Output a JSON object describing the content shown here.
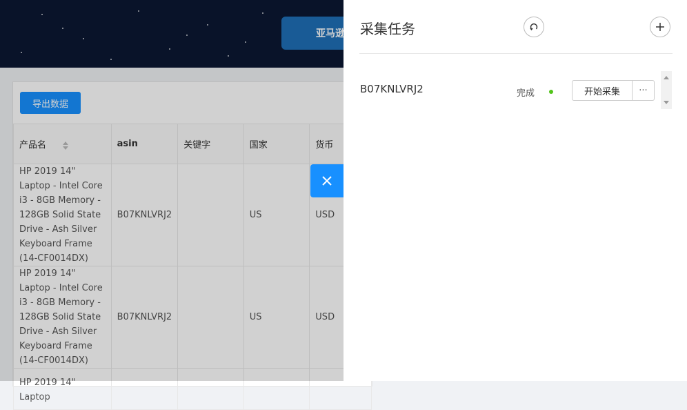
{
  "banner": {
    "button_label": "亚马逊"
  },
  "toolbar": {
    "export_label": "导出数据"
  },
  "table": {
    "columns": [
      "产品名",
      "asin",
      "关键字",
      "国家",
      "货币"
    ],
    "rows": [
      {
        "name": "HP 2019 14\" Laptop - Intel Core i3 - 8GB Memory - 128GB Solid State Drive - Ash Silver Keyboard Frame (14-CF0014DX)",
        "asin": "B07KNLVRJ2",
        "keyword": "",
        "country": "US",
        "currency": "USD"
      },
      {
        "name": "HP 2019 14\" Laptop - Intel Core i3 - 8GB Memory - 128GB Solid State Drive - Ash Silver Keyboard Frame (14-CF0014DX)",
        "asin": "B07KNLVRJ2",
        "keyword": "",
        "country": "US",
        "currency": "USD"
      },
      {
        "name": "HP 2019 14\" Laptop",
        "asin": "",
        "keyword": "",
        "country": "",
        "currency": ""
      }
    ]
  },
  "drawer": {
    "title": "采集任务",
    "task": {
      "asin": "B07KNLVRJ2",
      "status": "完成",
      "start_label": "开始采集",
      "more_label": "···"
    }
  },
  "colors": {
    "accent": "#1890ff",
    "status_done": "#52c41a"
  },
  "icons": {
    "refresh": "refresh-icon",
    "add": "plus-icon",
    "close": "close-icon"
  }
}
